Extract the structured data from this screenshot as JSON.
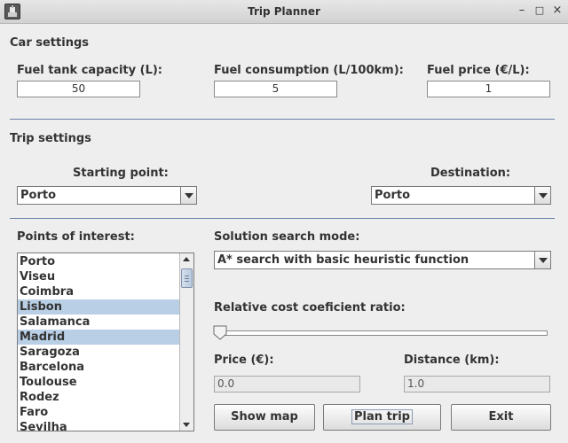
{
  "window": {
    "title": "Trip Planner",
    "minimize_glyph": "–",
    "maximize_glyph": "□",
    "close_glyph": "×"
  },
  "car_settings": {
    "heading": "Car settings",
    "fuel_tank_label": "Fuel tank capacity (L):",
    "fuel_tank_value": "50",
    "fuel_consumption_label": "Fuel consumption (L/100km):",
    "fuel_consumption_value": "5",
    "fuel_price_label": "Fuel price (€/L):",
    "fuel_price_value": "1"
  },
  "trip_settings": {
    "heading": "Trip settings",
    "starting_point_label": "Starting point:",
    "starting_point_value": "Porto",
    "destination_label": "Destination:",
    "destination_value": "Porto"
  },
  "points_of_interest": {
    "label": "Points of interest:",
    "items": [
      {
        "label": "Porto",
        "selected": false
      },
      {
        "label": "Viseu",
        "selected": false
      },
      {
        "label": "Coimbra",
        "selected": false
      },
      {
        "label": "Lisbon",
        "selected": true
      },
      {
        "label": "Salamanca",
        "selected": false
      },
      {
        "label": "Madrid",
        "selected": true
      },
      {
        "label": "Saragoza",
        "selected": false
      },
      {
        "label": "Barcelona",
        "selected": false
      },
      {
        "label": "Toulouse",
        "selected": false
      },
      {
        "label": "Rodez",
        "selected": false
      },
      {
        "label": "Faro",
        "selected": false
      },
      {
        "label": "Sevilha",
        "selected": false
      }
    ]
  },
  "search": {
    "mode_label": "Solution search mode:",
    "mode_value": "A* search with basic heuristic function",
    "ratio_label": "Relative cost coeficient ratio:",
    "ratio_value": 0
  },
  "results": {
    "price_label": "Price (€):",
    "price_value": "0.0",
    "distance_label": "Distance (km):",
    "distance_value": "1.0"
  },
  "buttons": {
    "show_map": "Show map",
    "plan_trip": "Plan trip",
    "exit": "Exit"
  },
  "colors": {
    "separator": "#6a7fa8",
    "selection": "#b8cfe5",
    "window_bg": "#eeeeee"
  }
}
